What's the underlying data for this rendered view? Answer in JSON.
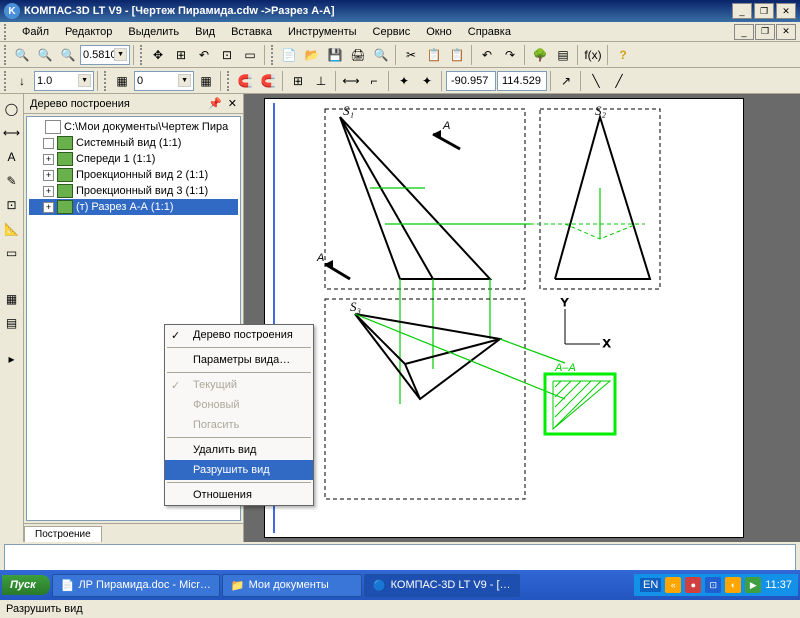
{
  "title": "КОМПАС-3D LT V9 - [Чертеж Пирамида.cdw ->Разрез А-А]",
  "menu": {
    "file": "Файл",
    "edit": "Редактор",
    "select": "Выделить",
    "view": "Вид",
    "insert": "Вставка",
    "tools": "Инструменты",
    "service": "Сервис",
    "window": "Окно",
    "help": "Справка"
  },
  "zoom": "0.5810",
  "scale": "1.0",
  "layer": "0",
  "coords": {
    "x": "-90.957",
    "y": "114.529"
  },
  "tree": {
    "title": "Дерево построения",
    "root": "С:\\Мои документы\\Чертеж Пира",
    "items": [
      "Системный вид (1:1)",
      "Спереди 1 (1:1)",
      "Проекционный вид 2 (1:1)",
      "Проекционный вид 3 (1:1)",
      "(т) Разрез А-А (1:1)"
    ],
    "tab": "Построение"
  },
  "contextmenu": {
    "items": [
      "Дерево построения",
      "Параметры вида…",
      "Текущий",
      "Фоновый",
      "Погасить",
      "Удалить вид",
      "Разрушить вид",
      "Отношения"
    ],
    "selected": "Разрушить вид"
  },
  "drawing": {
    "markerA": "А",
    "section": "А–А",
    "labels": {
      "s1": "S₁",
      "s2": "S₂",
      "s3": "S₃"
    }
  },
  "status": "Разрушить вид",
  "taskbar": {
    "start": "Пуск",
    "tasks": [
      "ЛР Пирамида.doc - Micr…",
      "Мои документы",
      "КОМПАС-3D LT V9 - […"
    ],
    "lang": "EN",
    "time": "11:37"
  }
}
